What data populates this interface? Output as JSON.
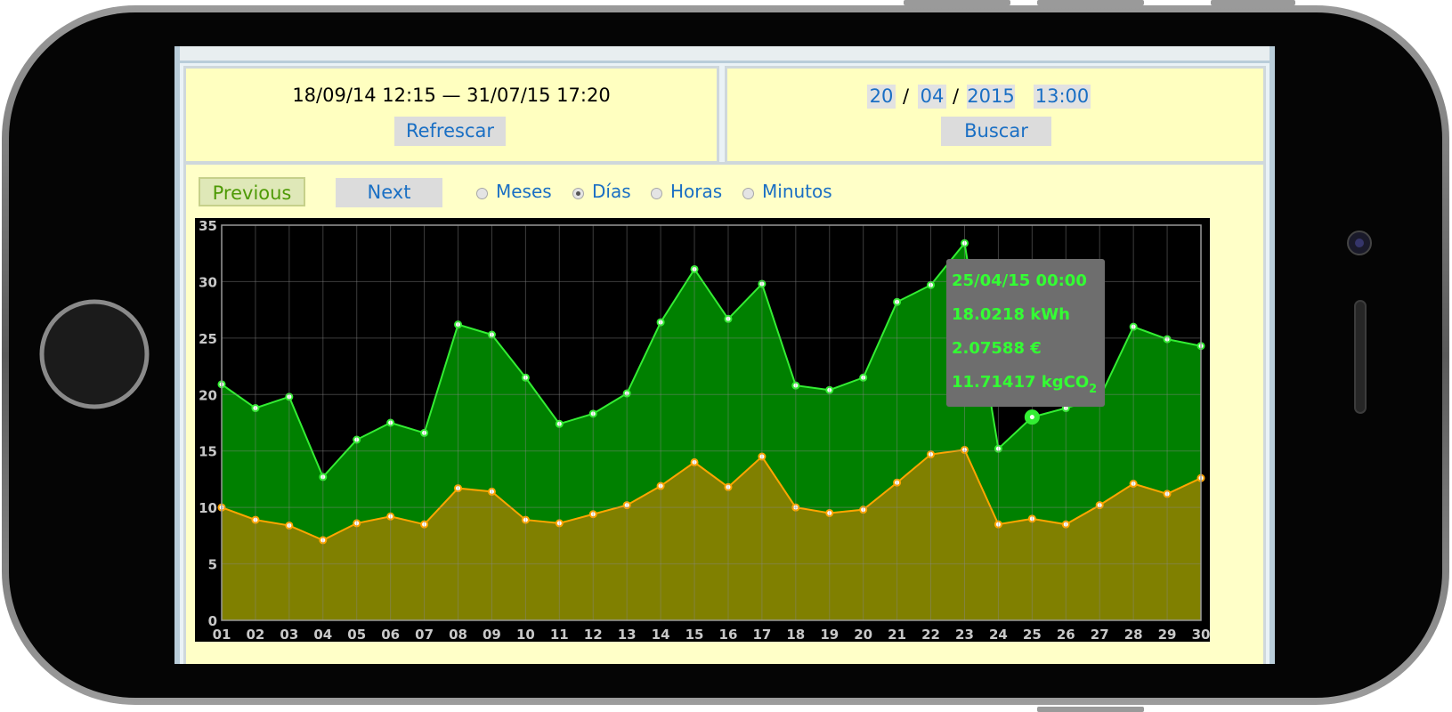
{
  "range": {
    "text": "18/09/14 12:15 — 31/07/15 17:20",
    "refresh_label": "Refrescar"
  },
  "date_search": {
    "day": "20",
    "month": "04",
    "year": "2015",
    "time": "13:00",
    "sep1": "/",
    "sep2": "/",
    "search_label": "Buscar"
  },
  "nav": {
    "previous_label": "Previous",
    "next_label": "Next"
  },
  "granularity": {
    "options": [
      "Meses",
      "Días",
      "Horas",
      "Minutos"
    ],
    "selected": "Días"
  },
  "tooltip": {
    "date": "25/04/15 00:00",
    "energy": "18.0218 kWh",
    "cost": "2.07588 €",
    "co2": "11.71417 kgCO",
    "co2_sub": "2"
  },
  "colors": {
    "energy_line": "#33ee33",
    "energy_fill": "#008000",
    "cost_line": "#ffa500",
    "cost_fill": "#808000",
    "tooltip_bg": "#6e6e6e",
    "tooltip_text": "#33ff33"
  },
  "chart_data": {
    "type": "area",
    "x": [
      "01",
      "02",
      "03",
      "04",
      "05",
      "06",
      "07",
      "08",
      "09",
      "10",
      "11",
      "12",
      "13",
      "14",
      "15",
      "16",
      "17",
      "18",
      "19",
      "20",
      "21",
      "22",
      "23",
      "24",
      "25",
      "26",
      "27",
      "28",
      "29",
      "30"
    ],
    "series": [
      {
        "values": [
          20.9,
          18.8,
          19.8,
          12.7,
          16.0,
          17.5,
          16.6,
          26.2,
          25.3,
          21.5,
          17.4,
          18.3,
          20.1,
          26.4,
          31.1,
          26.7,
          29.8,
          20.8,
          20.4,
          21.5,
          28.2,
          29.7,
          33.4,
          15.2,
          18.0,
          18.8,
          19.7,
          26.0,
          24.9,
          24.3
        ]
      },
      {
        "values": [
          10.0,
          8.9,
          8.4,
          7.1,
          8.6,
          9.2,
          8.5,
          11.7,
          11.4,
          8.9,
          8.6,
          9.4,
          10.2,
          11.9,
          14.0,
          11.8,
          14.5,
          10.0,
          9.5,
          9.8,
          12.2,
          14.7,
          15.1,
          8.5,
          9.0,
          8.5,
          10.2,
          12.1,
          11.2,
          12.6
        ]
      }
    ],
    "ylim": [
      0,
      35
    ],
    "yticks": [
      0,
      5,
      10,
      15,
      20,
      25,
      30,
      35
    ],
    "grid": true
  }
}
